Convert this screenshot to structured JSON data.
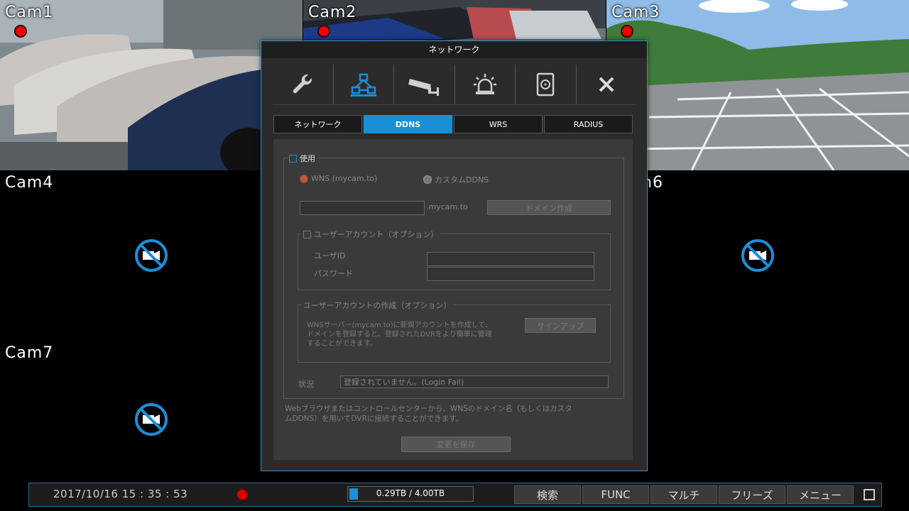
{
  "cameras": [
    {
      "label": "Cam1",
      "recording": true,
      "has_video": true
    },
    {
      "label": "Cam2",
      "recording": true,
      "has_video": true
    },
    {
      "label": "Cam3",
      "recording": true,
      "has_video": true
    },
    {
      "label": "Cam4",
      "recording": false,
      "has_video": false
    },
    {
      "label": "n6",
      "recording": false,
      "has_video": false
    },
    {
      "label": "Cam7",
      "recording": false,
      "has_video": false
    }
  ],
  "dialog": {
    "title": "ネットワーク",
    "icons": [
      "wrench-icon",
      "network-icon",
      "camera-icon",
      "alarm-icon",
      "storage-icon",
      "close-icon"
    ],
    "tabs": [
      {
        "label": "ネットワーク",
        "active": false
      },
      {
        "label": "DDNS",
        "active": true
      },
      {
        "label": "WRS",
        "active": false
      },
      {
        "label": "RADIUS",
        "active": false
      }
    ],
    "use_label": "使用",
    "radio_wns": "WNS (mycam.to)",
    "radio_custom": "カスタムDDNS",
    "domain_value": "",
    "domain_suffix": ".mycam.to",
    "create_domain_button": "ドメイン作成",
    "user_account_legend": "ユーザーアカウント（オプション）",
    "user_id_label": "ユーザID",
    "password_label": "パスワード",
    "create_account_legend": "ユーザーアカウントの作成（オプション）",
    "create_account_text_1": "WNSサーバー(mycam.to)に新規アカウントを作成して、",
    "create_account_text_2": "ドメインを登録すると、登録されたDVRをより簡単に管理",
    "create_account_text_3": "することができます。",
    "signup_button": "サインアップ",
    "status_label": "状況",
    "status_value": "登録されていません。(Login Fail)",
    "info_text_1": "Webブラウザまたはコントロールセンターから、WNSのドメイン名（もしくはカスタ",
    "info_text_2": "ムDDNS）を用いてDVRに接続することができます。",
    "save_button": "変更を保存"
  },
  "bottombar": {
    "datetime": "2017/10/16  15 : 35 : 53",
    "storage_text": "0.29TB / 4.00TB",
    "storage_fraction": 0.07,
    "buttons": [
      "検索",
      "FUNC",
      "マルチ",
      "フリーズ",
      "メニュー"
    ]
  },
  "colors": {
    "accent": "#1a8fd6",
    "rec": "#e00000",
    "nocam": "#1a8fd6"
  }
}
